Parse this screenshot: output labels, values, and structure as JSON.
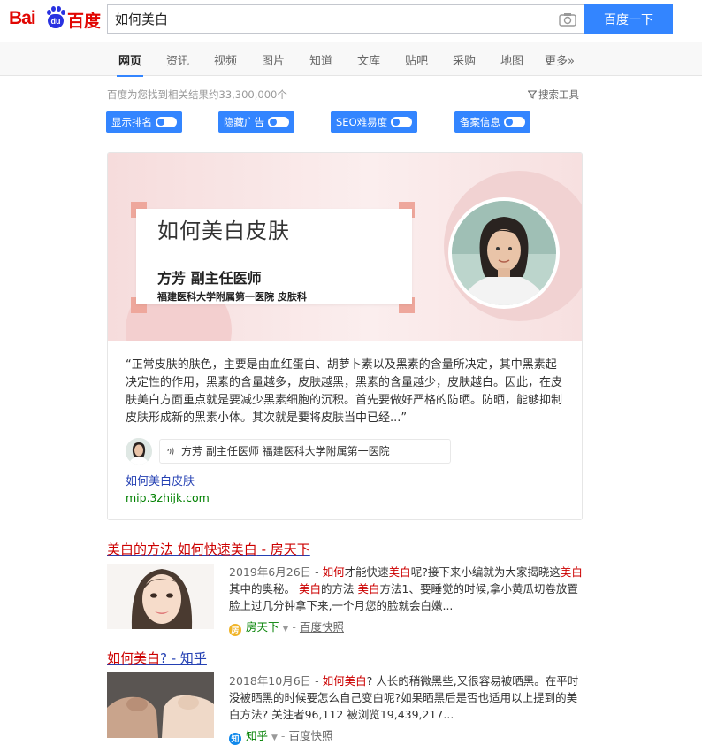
{
  "header": {
    "logo_text_left": "Bai",
    "logo_paw_text": "du",
    "logo_text_right": "百度",
    "search_value": "如何美白",
    "search_button": "百度一下"
  },
  "tabs": [
    {
      "label": "网页",
      "active": true
    },
    {
      "label": "资讯",
      "active": false
    },
    {
      "label": "视频",
      "active": false
    },
    {
      "label": "图片",
      "active": false
    },
    {
      "label": "知道",
      "active": false
    },
    {
      "label": "文库",
      "active": false
    },
    {
      "label": "贴吧",
      "active": false
    },
    {
      "label": "采购",
      "active": false
    },
    {
      "label": "地图",
      "active": false
    },
    {
      "label": "更多»",
      "active": false
    }
  ],
  "result_count": "百度为您找到相关结果约33,300,000个",
  "search_tools": "搜索工具",
  "toggles": [
    {
      "label": "显示排名",
      "on": false
    },
    {
      "label": "隐藏广告",
      "on": false
    },
    {
      "label": "SEO难易度",
      "on": false
    },
    {
      "label": "备案信息",
      "on": false
    }
  ],
  "featured": {
    "banner_title": "如何美白皮肤",
    "banner_doctor": "方芳  副主任医师",
    "banner_hospital": "福建医科大学附属第一医院 皮肤科",
    "quote": "“正常皮肤的肤色，主要是由血红蛋白、胡萝卜素以及黑素的含量所决定，其中黑素起决定性的作用，黑素的含量越多，皮肤越黑，黑素的含量越少，皮肤越白。因此，在皮肤美白方面重点就是要减少黑素细胞的沉积。首先要做好严格的防晒。防晒，能够抑制皮肤形成新的黑素小体。其次就是要将皮肤当中已经...”",
    "author": "方芳   副主任医师   福建医科大学附属第一医院",
    "link": "如何美白皮肤",
    "url": "mip.3zhijk.com"
  },
  "results": [
    {
      "title_a": "美白的方法",
      "title_b": " 如何快速美白",
      "title_c": " - 房天下",
      "date": "2019年6月26日 - ",
      "s1": "如何",
      "s2": "才能快速",
      "s3": "美白",
      "s4": "呢?接下来小编就为大家揭晓这",
      "s5": "美白",
      "s6": "其中的奥秘。 ",
      "s7": "美白",
      "s8": "的方法 ",
      "s9": "美白",
      "s10": "方法1、要睡觉的时候,拿小黄瓜切卷放置脸上过几分钟拿下来,一个月您的脸就会白嫩...",
      "source": "房天下",
      "snapshot": "百度快照"
    },
    {
      "title_a": "如何美白",
      "title_b": "? - 知乎",
      "date": "2018年10月6日 - ",
      "s1": "如何美白",
      "s2": "? 人长的稍微黑些,又很容易被晒黑。在平时没被晒黑的时候要怎么自己变白呢?如果晒黑后是否也适用以上提到的美白方法? 关注者96,112 被浏览19,439,217...",
      "source": "知乎",
      "snapshot": "百度快照"
    }
  ],
  "colors": {
    "brand_red": "#e10602",
    "brand_blue": "#2932e1",
    "button_blue": "#3385ff",
    "link_blue": "#2440b3",
    "highlight_red": "#c00",
    "url_green": "#008000"
  }
}
